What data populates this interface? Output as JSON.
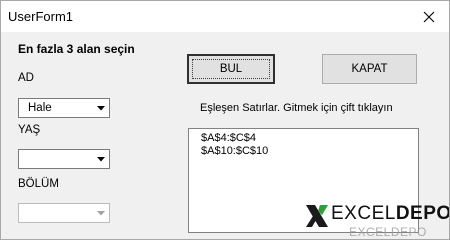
{
  "window": {
    "title": "UserForm1"
  },
  "form": {
    "heading": "En fazla 3 alan seçin",
    "fields": [
      {
        "label": "AD",
        "value": "Hale",
        "enabled": true
      },
      {
        "label": "YAŞ",
        "value": "",
        "enabled": true
      },
      {
        "label": "BÖLÜM",
        "value": "",
        "enabled": false
      }
    ]
  },
  "buttons": {
    "find": "BUL",
    "close": "KAPAT"
  },
  "results": {
    "hint": "Eşleşen Satırlar. Gitmek için çift tıklayın",
    "items": [
      "$A$4:$C$4",
      "$A$10:$C$10"
    ]
  },
  "logo": {
    "brand_excel": "EXCEL",
    "brand_depo": "DEPO",
    "ghost_text": "EXCELDEPO"
  },
  "icons": {
    "close": "close-icon",
    "dropdown": "chevron-down-icon",
    "logo": "excel-depo-x-logo-icon"
  }
}
